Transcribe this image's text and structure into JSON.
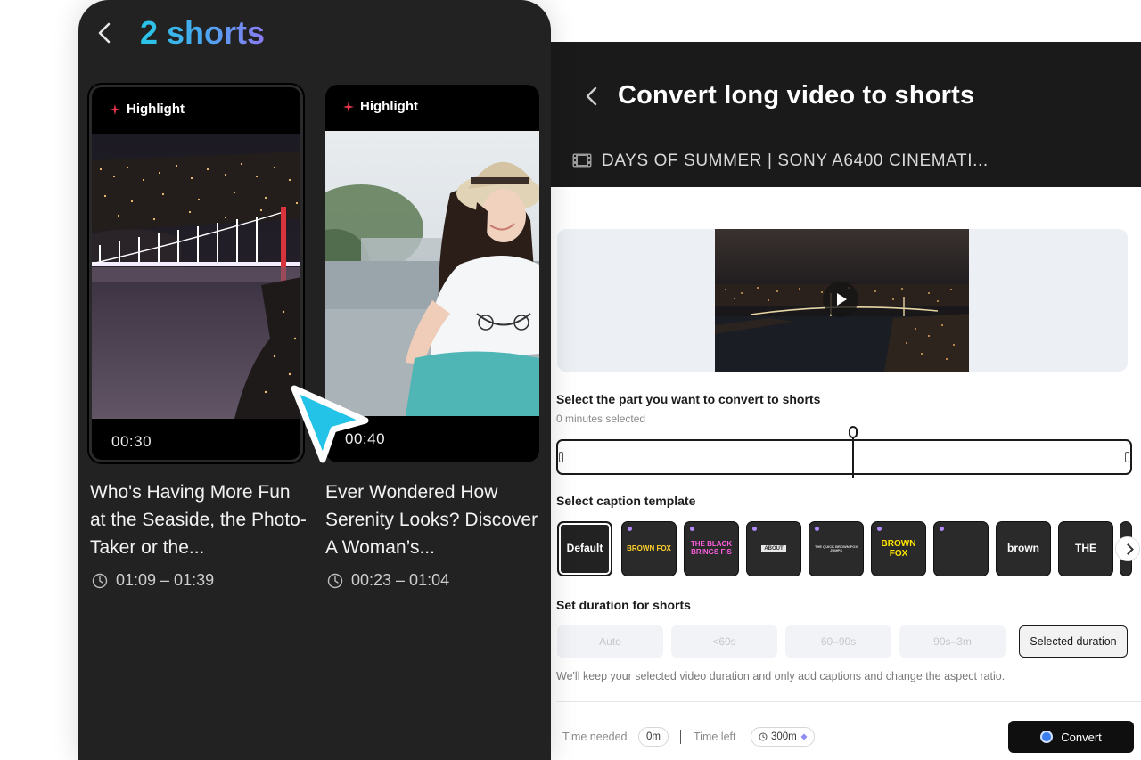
{
  "mobile": {
    "title": "2 shorts",
    "cards": [
      {
        "tag": "Highlight",
        "duration": "00:30",
        "title": "Who's Having More Fun at the Seaside, the Photo-Taker or the...",
        "range": "01:09 – 01:39"
      },
      {
        "tag": "Highlight",
        "duration": "00:40",
        "title": "Ever Wondered How Serenity Looks? Discover A Woman’s...",
        "range": "00:23 – 01:04"
      }
    ]
  },
  "desktop": {
    "title": "Convert long video to shorts",
    "filename": "DAYS OF SUMMER | SONY A6400 CINEMATI...",
    "select_part_title": "Select the part you want to convert to shorts",
    "select_part_sub": "0 minutes selected",
    "caption_title": "Select caption template",
    "templates": [
      {
        "label": "Default"
      },
      {
        "label": "BROWN FOX"
      },
      {
        "label": "THE BLACK BRINGS FIS"
      },
      {
        "label": "ABOUT"
      },
      {
        "label": "THE QUICK BROWN FOX JUMPS"
      },
      {
        "label": "BROWN FOX"
      },
      {
        "label": ""
      },
      {
        "label": "brown"
      },
      {
        "label": "THE"
      }
    ],
    "duration_title": "Set duration for shorts",
    "durations": [
      "Auto",
      "<60s",
      "60–90s",
      "90s–3m",
      "Selected duration"
    ],
    "duration_note": "We'll keep your selected video duration and only add captions and change the aspect ratio.",
    "time_needed_label": "Time needed",
    "time_needed_value": "0m",
    "time_left_label": "Time left",
    "time_left_value": "300m",
    "convert_label": "Convert"
  },
  "colors": {
    "dark_bg": "#222222",
    "header_bg": "#1a1a1a",
    "title_gradient_start": "#27c6e6",
    "title_gradient_end": "#8a7af2",
    "accent_red": "#e8344a",
    "cursor_cyan": "#22c3e6"
  }
}
